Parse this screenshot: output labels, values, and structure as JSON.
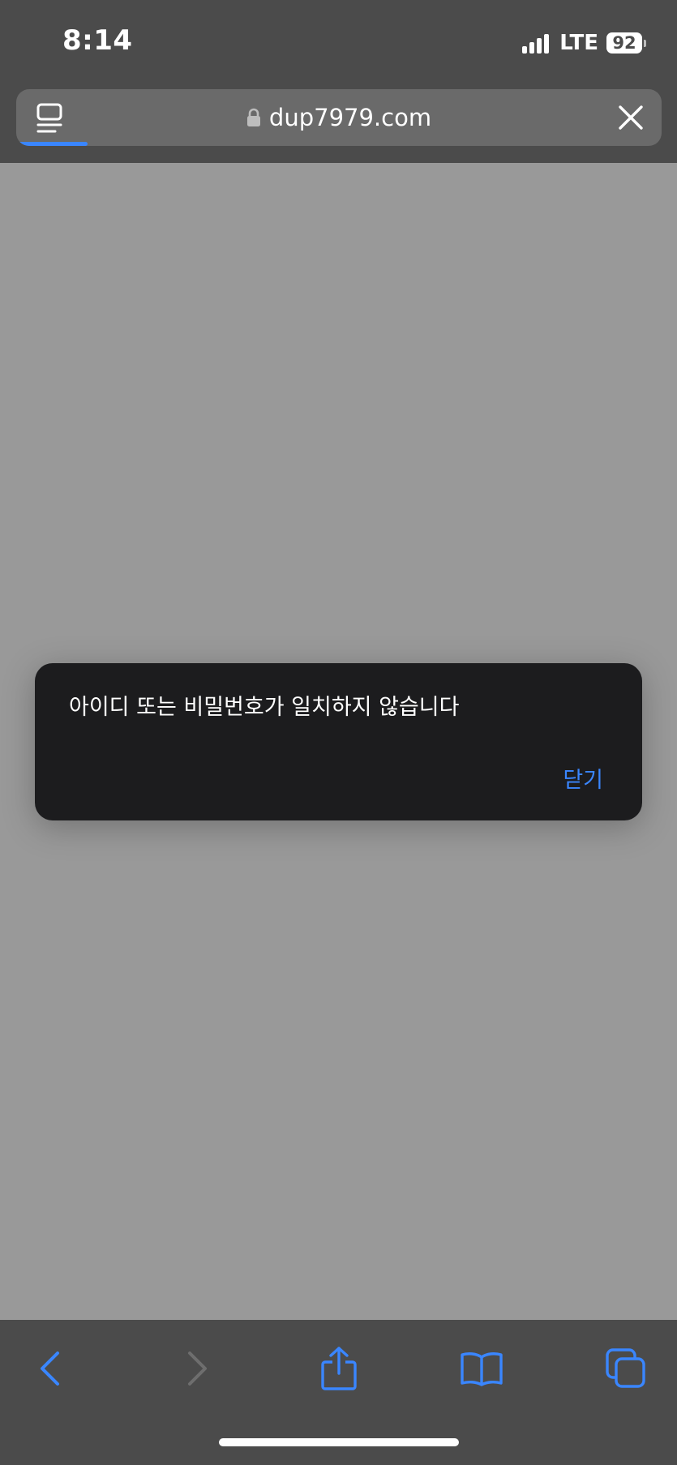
{
  "status_bar": {
    "time": "8:14",
    "network": "LTE",
    "battery": "92"
  },
  "url_bar": {
    "url": "dup7979.com",
    "load_progress": 0.11
  },
  "alert": {
    "message": "아이디 또는 비밀번호가 일치하지 않습니다",
    "button_label": "닫기"
  },
  "toolbar": {
    "buttons": [
      "back",
      "forward",
      "share",
      "bookmarks",
      "tabs"
    ]
  },
  "colors": {
    "accent": "#3a86ff",
    "chrome_bg": "#4b4b4b",
    "page_dim": "#999999",
    "alert_bg": "#1c1c1e"
  },
  "icons": [
    "reader-icon",
    "lock-icon",
    "close-icon",
    "back-icon",
    "forward-icon",
    "share-icon",
    "bookmarks-icon",
    "tabs-icon"
  ]
}
